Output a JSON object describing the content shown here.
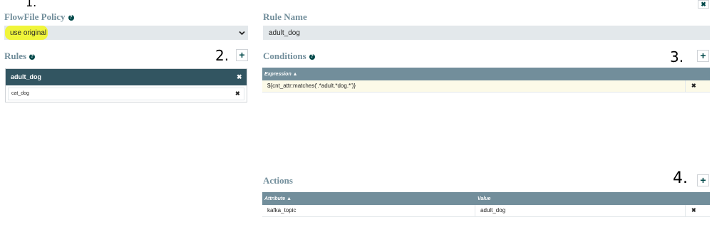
{
  "flowfile_policy": {
    "title": "FlowFile Policy",
    "selected_value": "use original",
    "annotation": "1."
  },
  "rules": {
    "title": "Rules",
    "annotation": "2.",
    "items": [
      {
        "label": "adult_dog",
        "selected": true
      },
      {
        "label": "cat_dog",
        "selected": false
      }
    ]
  },
  "rule_name": {
    "title": "Rule Name",
    "value": "adult_dog"
  },
  "conditions": {
    "title": "Conditions",
    "annotation": "3.",
    "column_header": "Expression ▲",
    "rows": [
      {
        "expression": "${cnt_attr:matches('.*adult.*dog.*')}"
      }
    ]
  },
  "actions": {
    "title": "Actions",
    "annotation": "4.",
    "columns": [
      "Attribute ▲",
      "Value"
    ],
    "rows": [
      {
        "attribute": "kafka_topic",
        "value": "adult_dog"
      }
    ]
  },
  "glyphs": {
    "plus": "+",
    "close": "✖",
    "help": "?",
    "chevron": "⌄"
  },
  "colors": {
    "heading": "#728e9b",
    "selected_rule_bg": "#325561",
    "highlight": "#f0f53a",
    "table_header_bg": "#728e9b",
    "condition_row_bg": "#fcfae8"
  }
}
